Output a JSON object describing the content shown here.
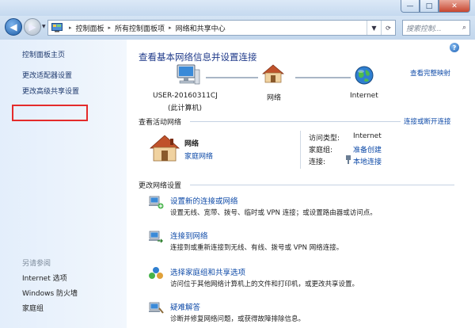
{
  "window": {
    "min_label": "—",
    "max_label": "□",
    "close_label": "✕"
  },
  "addressbar": {
    "breadcrumb": [
      "控制面板",
      "所有控制面板项",
      "网络和共享中心"
    ],
    "search_placeholder": "搜索控制..."
  },
  "sidebar": {
    "home": "控制面板主页",
    "change_adapter": "更改适配器设置",
    "change_advanced_sharing": "更改高级共享设置",
    "see_also_title": "另请参阅",
    "see_also": [
      "Internet 选项",
      "Windows 防火墙",
      "家庭组"
    ]
  },
  "main": {
    "title": "查看基本网络信息并设置连接",
    "view_full_map": "查看完整映射",
    "nodes": [
      {
        "label": "USER-20160311CJ",
        "sublabel": "(此计算机)"
      },
      {
        "label": "网络",
        "sublabel": ""
      },
      {
        "label": "Internet",
        "sublabel": ""
      }
    ],
    "active_networks_title": "查看活动网络",
    "connect_disconnect": "连接或断开连接",
    "network": {
      "name": "网络",
      "type": "家庭网络",
      "access_type_label": "访问类型:",
      "access_type_value": "Internet",
      "homegroup_label": "家庭组:",
      "homegroup_value": "准备创建",
      "connection_label": "连接:",
      "connection_value": "本地连接"
    },
    "change_settings_title": "更改网络设置",
    "tasks": [
      {
        "title": "设置新的连接或网络",
        "desc": "设置无线、宽带、拨号、临时或 VPN 连接；或设置路由器或访问点。"
      },
      {
        "title": "连接到网络",
        "desc": "连接到或重新连接到无线、有线、拨号或 VPN 网络连接。"
      },
      {
        "title": "选择家庭组和共享选项",
        "desc": "访问位于其他网络计算机上的文件和打印机，或更改共享设置。"
      },
      {
        "title": "疑难解答",
        "desc": "诊断并修复网络问题，或获得故障排除信息。"
      }
    ]
  },
  "colors": {
    "link": "#0f4ba8",
    "title": "#1f3a8a",
    "highlight_box": "#e42b2b",
    "sidebar_bg": "#e3eefb"
  }
}
